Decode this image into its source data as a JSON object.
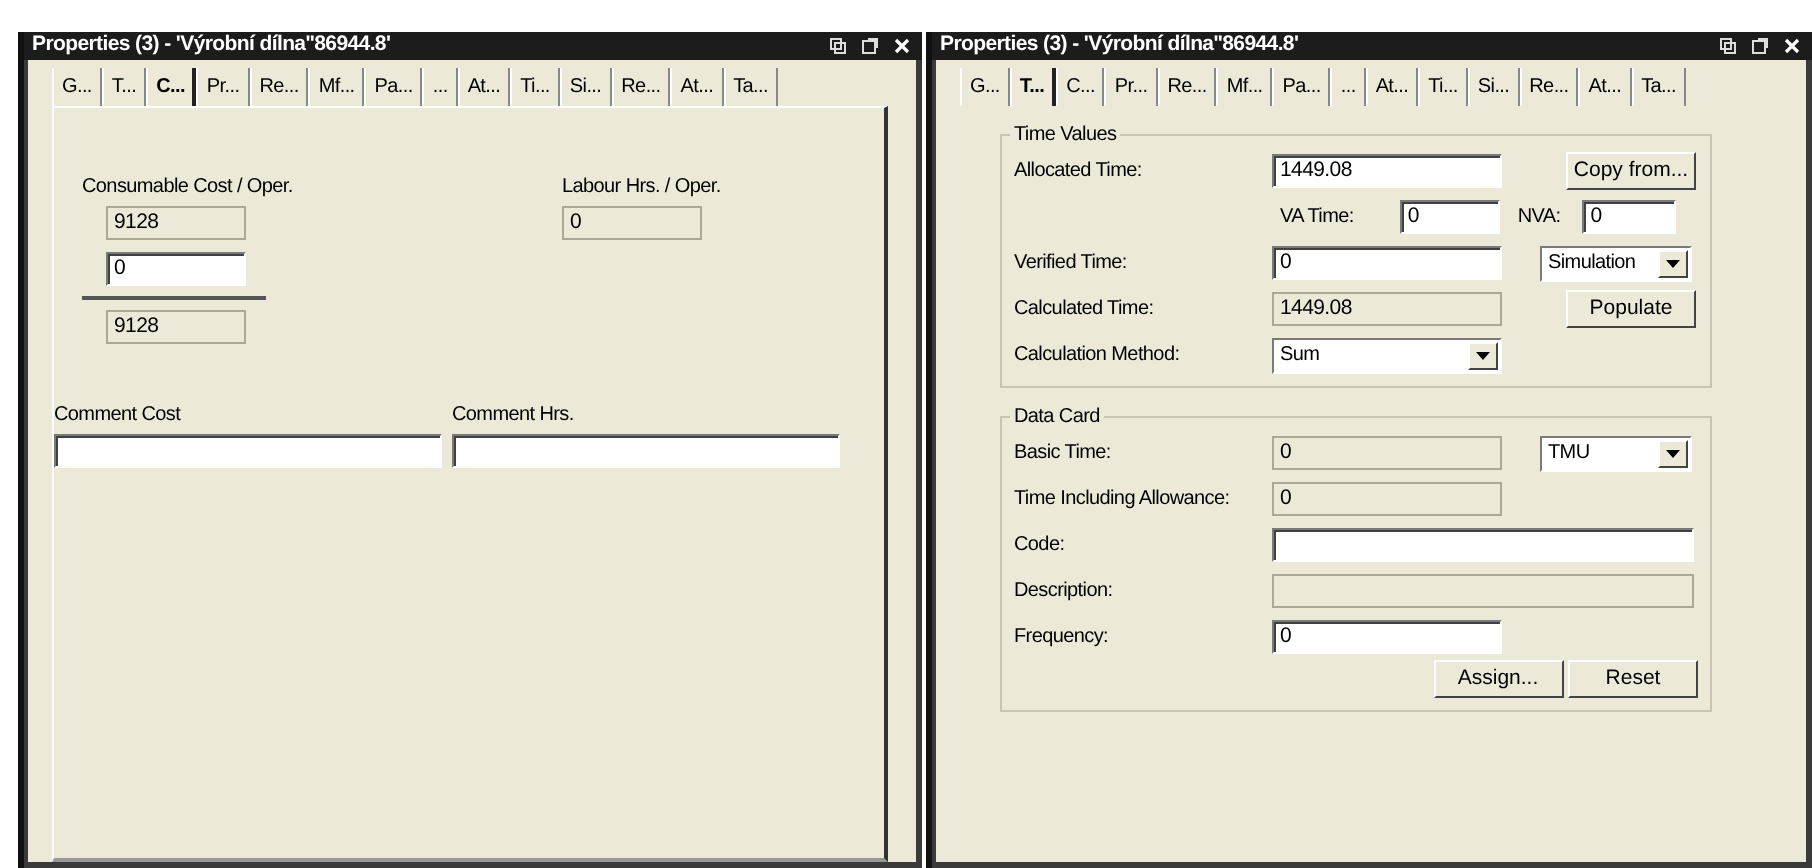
{
  "panels": [
    {
      "kind": "cost",
      "title": "Properties (3) - 'Výrobní dílna''86944.8'",
      "tabs": [
        {
          "label": "G...",
          "selected": false
        },
        {
          "label": "T...",
          "selected": false
        },
        {
          "label": "C...",
          "selected": true
        },
        {
          "label": "Pr...",
          "selected": false
        },
        {
          "label": "Re...",
          "selected": false
        },
        {
          "label": "Mf...",
          "selected": false
        },
        {
          "label": "Pa...",
          "selected": false
        },
        {
          "label": "...",
          "selected": false
        },
        {
          "label": "At...",
          "selected": false
        },
        {
          "label": "Ti...",
          "selected": false
        },
        {
          "label": "Si...",
          "selected": false
        },
        {
          "label": "Re...",
          "selected": false
        },
        {
          "label": "At...",
          "selected": false
        },
        {
          "label": "Ta...",
          "selected": false
        }
      ],
      "cost": {
        "label": "Consumable Cost / Oper.",
        "fields": [
          {
            "value": "9128",
            "disabled": true
          },
          {
            "value": "0",
            "disabled": false
          },
          {
            "value": "9128",
            "disabled": true
          }
        ]
      },
      "labour": {
        "label": "Labour Hrs. / Oper.",
        "value": "0",
        "disabled": true
      },
      "comments": [
        {
          "label": "Comment Cost",
          "disabled": false
        },
        {
          "label": "Comment Hrs.",
          "disabled": false
        }
      ]
    },
    {
      "kind": "time",
      "title": "Properties (3) - 'Výrobní dílna''86944.8'",
      "tabs": [
        {
          "label": "G...",
          "selected": false
        },
        {
          "label": "T...",
          "selected": true
        },
        {
          "label": "C...",
          "selected": false
        },
        {
          "label": "Pr...",
          "selected": false
        },
        {
          "label": "Re...",
          "selected": false
        },
        {
          "label": "Mf...",
          "selected": false
        },
        {
          "label": "Pa...",
          "selected": false
        },
        {
          "label": "...",
          "selected": false
        },
        {
          "label": "At...",
          "selected": false
        },
        {
          "label": "Ti...",
          "selected": false
        },
        {
          "label": "Si...",
          "selected": false
        },
        {
          "label": "Re...",
          "selected": false
        },
        {
          "label": "At...",
          "selected": false
        },
        {
          "label": "Ta...",
          "selected": false
        }
      ],
      "groups": [
        {
          "legend": "Time Values",
          "rows": [
            {
              "kind": "pair",
              "label": "Allocated Time:",
              "field": {
                "kind": "text",
                "value": "1449.08",
                "disabled": false
              },
              "side": {
                "kind": "button",
                "text": "Copy from..."
              }
            },
            {
              "kind": "sub",
              "items": [
                {
                  "label": "VA Time:",
                  "value": "0",
                  "disabled": false
                },
                {
                  "label": "NVA:",
                  "value": "0",
                  "disabled": false
                }
              ]
            },
            {
              "kind": "pair",
              "label": "Verified Time:",
              "field": {
                "kind": "text",
                "value": "0",
                "disabled": false
              },
              "side": {
                "kind": "select",
                "text": "Simulation"
              }
            },
            {
              "kind": "pair",
              "label": "Calculated Time:",
              "field": {
                "kind": "text",
                "value": "1449.08",
                "disabled": true
              },
              "side": {
                "kind": "button",
                "text": "Populate"
              }
            },
            {
              "kind": "pair",
              "label": "Calculation Method:",
              "field": {
                "kind": "select",
                "value": "Sum",
                "disabled": false
              }
            }
          ]
        },
        {
          "legend": "Data Card",
          "rows": [
            {
              "kind": "pair",
              "label": "Basic Time:",
              "field": {
                "kind": "text",
                "value": "0",
                "disabled": true
              },
              "side": {
                "kind": "select",
                "text": "TMU"
              }
            },
            {
              "kind": "pair",
              "label": "Time Including Allowance:",
              "field": {
                "kind": "text",
                "value": "0",
                "disabled": true
              }
            },
            {
              "kind": "wide",
              "label": "Code:",
              "field": {
                "kind": "text",
                "disabled": false
              }
            },
            {
              "kind": "wide",
              "label": "Description:",
              "field": {
                "kind": "text",
                "disabled": true
              }
            },
            {
              "kind": "pair",
              "label": "Frequency:",
              "field": {
                "kind": "text",
                "value": "0",
                "disabled": false
              }
            },
            {
              "kind": "buttons",
              "buttons": [
                "Assign...",
                "Reset"
              ]
            }
          ]
        }
      ]
    }
  ]
}
